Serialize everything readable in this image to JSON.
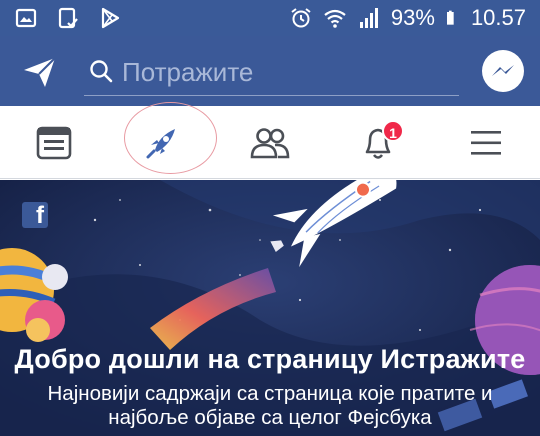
{
  "status_bar": {
    "battery_percent": "93%",
    "time": "10.57",
    "icons": [
      "image-icon",
      "clipboard-check-icon",
      "play-store-icon",
      "alarm-icon",
      "wifi-icon",
      "signal-icon",
      "battery-icon"
    ]
  },
  "top_bar": {
    "search_placeholder": "Потражите",
    "icons": [
      "compose-icon",
      "search-icon",
      "messenger-icon"
    ]
  },
  "tabs": [
    {
      "icon": "news-feed-icon"
    },
    {
      "icon": "explore-rocket-icon",
      "active": true
    },
    {
      "icon": "friends-icon"
    },
    {
      "icon": "notifications-bell-icon",
      "badge": "1"
    },
    {
      "icon": "menu-icon"
    }
  ],
  "hero": {
    "title": "Добро дошли на страницу Истражите",
    "subtitle": "Најновији садржаји са страница које пратите и најбоље објаве са целог Фејсбука"
  },
  "colors": {
    "brand": "#3b5998",
    "accent": "#4267b2",
    "badge": "#f02849"
  }
}
